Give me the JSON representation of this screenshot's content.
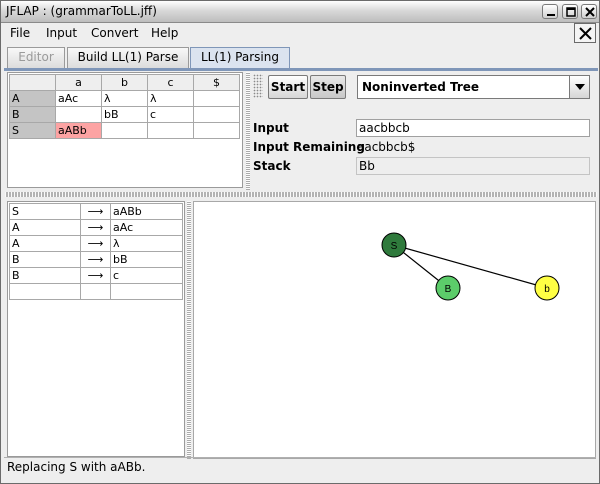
{
  "window": {
    "title": "JFLAP : (grammarToLL.jff)",
    "controls": [
      "minimize-icon",
      "maximize-icon",
      "close-icon"
    ]
  },
  "menubar": {
    "items": [
      "File",
      "Input",
      "Convert",
      "Help"
    ],
    "close_icon": "close-icon"
  },
  "tabs": [
    {
      "label": "Editor",
      "state": "disabled"
    },
    {
      "label": "Build LL(1) Parse",
      "state": "normal"
    },
    {
      "label": "LL(1) Parsing",
      "state": "selected"
    }
  ],
  "parse_table": {
    "columns": [
      "",
      "a",
      "b",
      "c",
      "$"
    ],
    "rows": [
      {
        "nonterminal": "A",
        "cells": [
          "aAc",
          "λ",
          "λ",
          ""
        ]
      },
      {
        "nonterminal": "B",
        "cells": [
          "",
          "bB",
          "c",
          ""
        ]
      },
      {
        "nonterminal": "S",
        "cells": [
          "aABb",
          "",
          "",
          ""
        ]
      }
    ],
    "highlighted": {
      "row": 2,
      "col": 0,
      "color": "#fca3a3"
    }
  },
  "controls": {
    "start_label": "Start",
    "step_label": "Step",
    "view_mode": "Noninverted Tree"
  },
  "fields": {
    "input_label": "Input",
    "input_value": "aacbbcb",
    "remaining_label": "Input Remaining",
    "remaining_value": "aacbbcb$",
    "stack_label": "Stack",
    "stack_value": "Bb"
  },
  "productions": [
    {
      "lhs": "S",
      "arrow": "⟶",
      "rhs": "aABb"
    },
    {
      "lhs": "A",
      "arrow": "⟶",
      "rhs": "aAc"
    },
    {
      "lhs": "A",
      "arrow": "⟶",
      "rhs": "λ"
    },
    {
      "lhs": "B",
      "arrow": "⟶",
      "rhs": "bB"
    },
    {
      "lhs": "B",
      "arrow": "⟶",
      "rhs": "c"
    },
    {
      "lhs": "",
      "arrow": "",
      "rhs": ""
    }
  ],
  "tree": {
    "nodes": [
      {
        "id": "S",
        "label": "S",
        "color": "#2f7a3c"
      },
      {
        "id": "B",
        "label": "B",
        "color": "#5ccc6a"
      },
      {
        "id": "b",
        "label": "b",
        "color": "#ffff44"
      }
    ],
    "edges": [
      [
        "S",
        "B"
      ],
      [
        "S",
        "b"
      ]
    ]
  },
  "status": "Replacing S with aABb."
}
